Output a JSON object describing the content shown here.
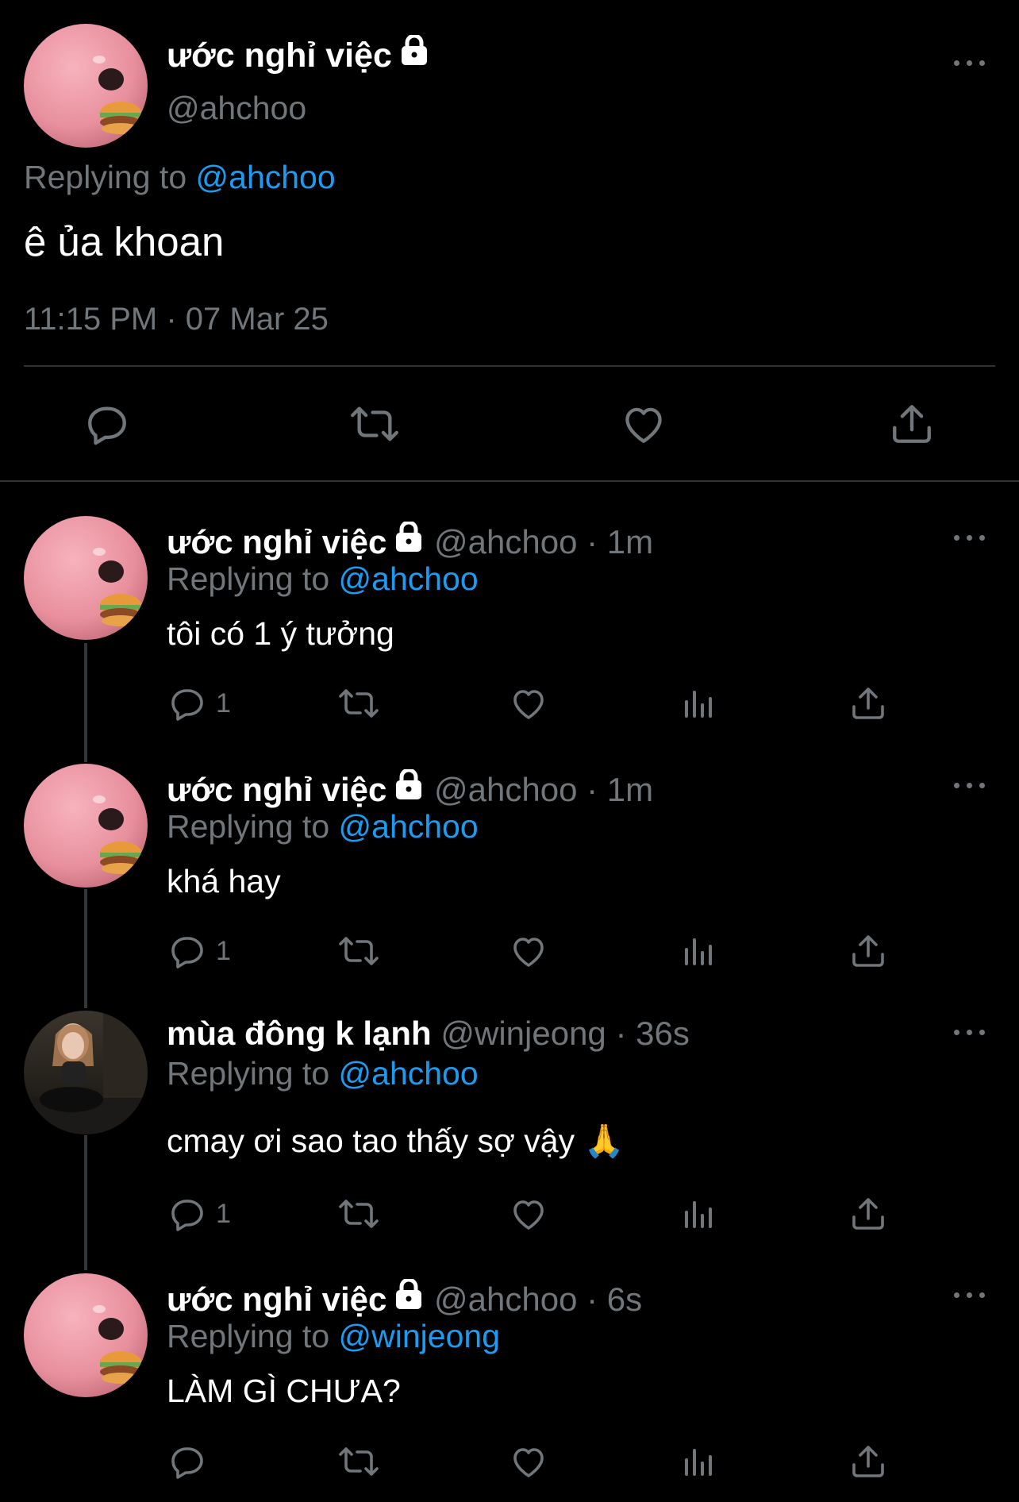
{
  "main_tweet": {
    "display_name": "ước nghỉ việc",
    "handle": "@ahchoo",
    "replying_prefix": "Replying to",
    "replying_to": "@ahchoo",
    "text": "ê ủa khoan",
    "timestamp": "11:15 PM · 07 Mar 25"
  },
  "replies": [
    {
      "display_name": "ước nghỉ việc",
      "handle": "@ahchoo",
      "time": "· 1m",
      "replying_prefix": "Replying to",
      "replying_to": "@ahchoo",
      "text": "tôi có 1 ý tưởng",
      "reply_count": "1"
    },
    {
      "display_name": "ước nghỉ việc",
      "handle": "@ahchoo",
      "time": "· 1m",
      "replying_prefix": "Replying to",
      "replying_to": "@ahchoo",
      "text": "khá hay",
      "reply_count": "1"
    },
    {
      "display_name": "mùa đông k lạnh",
      "handle": "@winjeong",
      "time": "· 36s",
      "replying_prefix": "Replying to",
      "replying_to": "@ahchoo",
      "text": "cmay ơi sao tao thấy sợ vậy 🙏",
      "reply_count": "1"
    },
    {
      "display_name": "ước nghỉ việc",
      "handle": "@ahchoo",
      "time": "· 6s",
      "replying_prefix": "Replying to",
      "replying_to": "@winjeong",
      "text": "LÀM GÌ CHƯA?",
      "reply_count": ""
    }
  ],
  "icons": {
    "lock": "lock-icon",
    "more": "more-icon",
    "reply": "reply-icon",
    "retweet": "retweet-icon",
    "like": "like-icon",
    "views": "views-icon",
    "share": "share-icon"
  },
  "colors": {
    "background": "#000000",
    "text": "#ffffff",
    "muted": "#71767b",
    "link": "#1d9bf0",
    "divider": "#2f3336"
  }
}
